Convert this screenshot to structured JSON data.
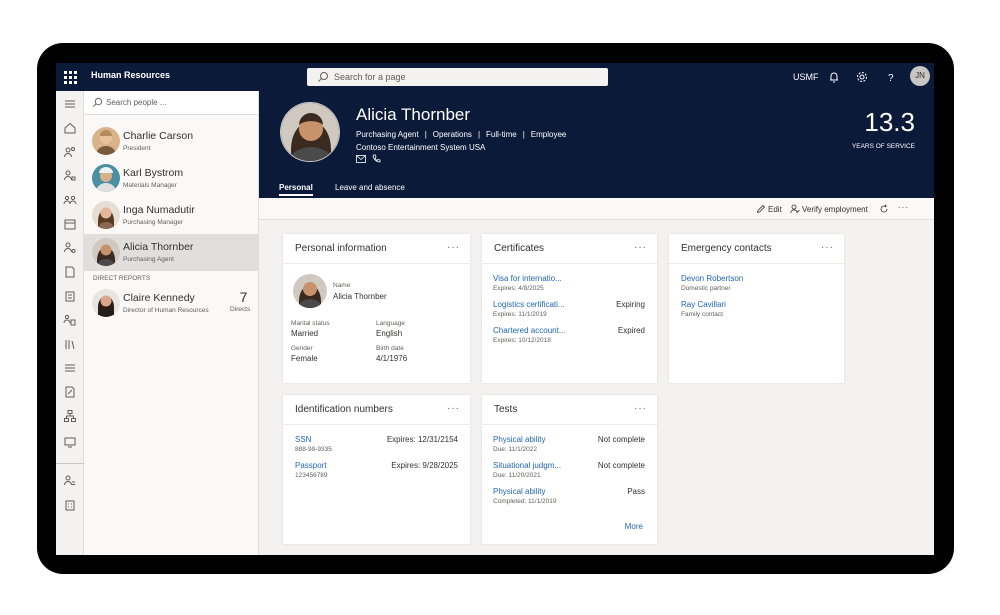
{
  "topbar": {
    "app_title": "Human Resources",
    "search_placeholder": "Search for a page",
    "company": "USMF",
    "user_initials": "JN"
  },
  "people_panel": {
    "search_placeholder": "Search people ...",
    "people": [
      {
        "name": "Charlie Carson",
        "role": "President"
      },
      {
        "name": "Karl Bystrom",
        "role": "Materials Manager"
      },
      {
        "name": "Inga Numadutir",
        "role": "Purchasing Manager"
      },
      {
        "name": "Alicia Thornber",
        "role": "Purchasing Agent",
        "selected": true
      }
    ],
    "direct_reports_label": "DIRECT REPORTS",
    "direct_reports": [
      {
        "name": "Claire Kennedy",
        "role": "Director of Human Resources",
        "directs_count": "7",
        "directs_label": "Directs"
      }
    ]
  },
  "employee": {
    "name": "Alicia Thornber",
    "title": "Purchasing Agent",
    "department": "Operations",
    "employment_type": "Full-time",
    "worker_type": "Employee",
    "company": "Contoso Entertainment System USA",
    "years_of_service": "13.3",
    "years_label": "YEARS OF SERVICE"
  },
  "tabs": [
    {
      "label": "Personal",
      "active": true
    },
    {
      "label": "Leave and absence",
      "active": false
    }
  ],
  "actions": {
    "edit": "Edit",
    "verify": "Verify employment"
  },
  "cards": {
    "personal_info": {
      "title": "Personal information",
      "name_label": "Name",
      "name_value": "Alicia Thornber",
      "marital_label": "Marital status",
      "marital_value": "Married",
      "language_label": "Language",
      "language_value": "English",
      "gender_label": "Gender",
      "gender_value": "Female",
      "birth_label": "Birth date",
      "birth_value": "4/1/1976"
    },
    "certificates": {
      "title": "Certificates",
      "items": [
        {
          "name": "Visa for internatio...",
          "expires": "Expires: 4/8/2025",
          "status": ""
        },
        {
          "name": "Logistics certificati...",
          "expires": "Expires: 11/1/2019",
          "status": "Expiring"
        },
        {
          "name": "Chartered account...",
          "expires": "Expires: 10/12/2018",
          "status": "Expired"
        }
      ]
    },
    "emergency": {
      "title": "Emergency contacts",
      "items": [
        {
          "name": "Devon Robertson",
          "relation": "Domestic partner"
        },
        {
          "name": "Ray Cavillari",
          "relation": "Family contact"
        }
      ]
    },
    "identification": {
      "title": "Identification numbers",
      "items": [
        {
          "type": "SSN",
          "number": "888-99-9335",
          "expires": "Expires: 12/31/2154"
        },
        {
          "type": "Passport",
          "number": "123456789",
          "expires": "Expires: 9/28/2025"
        }
      ]
    },
    "tests": {
      "title": "Tests",
      "items": [
        {
          "name": "Physical ability",
          "date": "Due: 11/1/2022",
          "status": "Not complete"
        },
        {
          "name": "Situational judgm...",
          "date": "Due: 11/20/2021",
          "status": "Not complete"
        },
        {
          "name": "Physical ability",
          "date": "Completed: 11/1/2019",
          "status": "Pass"
        }
      ],
      "more_link": "More"
    }
  },
  "colors": {
    "navy": "#0c1a3a",
    "link": "#2266b3",
    "selected_row": "#e1dfdd"
  }
}
